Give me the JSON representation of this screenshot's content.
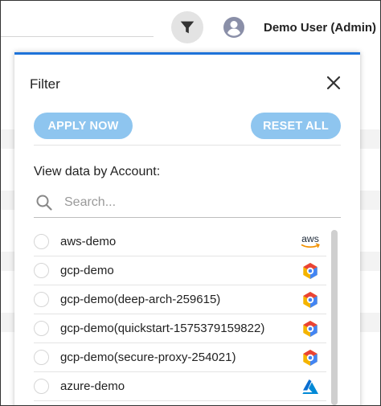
{
  "header": {
    "user_name": "Demo User (Admin)"
  },
  "filter_panel": {
    "title": "Filter",
    "apply_label": "APPLY NOW",
    "reset_label": "RESET ALL",
    "section_label": "View data by Account:",
    "search": {
      "placeholder": "Search...",
      "value": ""
    },
    "accounts": [
      {
        "label": "aws-demo",
        "provider": "aws-icon"
      },
      {
        "label": "gcp-demo",
        "provider": "gcp-icon"
      },
      {
        "label": "gcp-demo(deep-arch-259615)",
        "provider": "gcp-icon"
      },
      {
        "label": "gcp-demo(quickstart-1575379159822)",
        "provider": "gcp-icon"
      },
      {
        "label": "gcp-demo(secure-proxy-254021)",
        "provider": "gcp-icon"
      },
      {
        "label": "azure-demo",
        "provider": "azure-icon"
      }
    ],
    "aws_logo_text": "aws"
  },
  "colors": {
    "accent": "#1e73d9",
    "button_bg": "#8ec5ef",
    "filter_button_bg": "#e3e3e3"
  }
}
